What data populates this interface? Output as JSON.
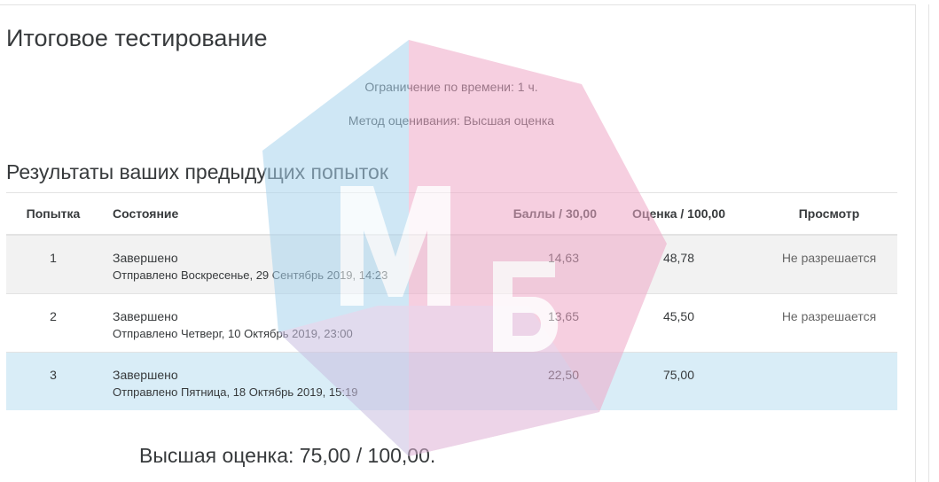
{
  "quiz": {
    "title": "Итоговое тестирование",
    "time_limit": "Ограничение по времени: 1 ч.",
    "grading_method": "Метод оценивания: Высшая оценка"
  },
  "results": {
    "heading": "Результаты ваших предыдущих попыток",
    "columns": {
      "attempt": "Попытка",
      "state": "Состояние",
      "points": "Баллы / 30,00",
      "grade": "Оценка / 100,00",
      "review": "Просмотр"
    },
    "rows": [
      {
        "attempt": "1",
        "state": "Завершено",
        "submitted": "Отправлено Воскресенье, 29 Сентябрь 2019, 14:23",
        "points": "14,63",
        "grade": "48,78",
        "review": "Не разрешается"
      },
      {
        "attempt": "2",
        "state": "Завершено",
        "submitted": "Отправлено Четверг, 10 Октябрь 2019, 23:00",
        "points": "13,65",
        "grade": "45,50",
        "review": "Не разрешается"
      },
      {
        "attempt": "3",
        "state": "Завершено",
        "submitted": "Отправлено Пятница, 18 Октябрь 2019, 15:19",
        "points": "22,50",
        "grade": "75,00",
        "review": ""
      }
    ],
    "best_grade": "Высшая оценка: 75,00 / 100,00."
  },
  "watermark": {
    "logo": "watermark-logo-icon",
    "letters": "Мб",
    "colors": {
      "blue": "#a9d4ee",
      "pink": "#f0a9c8",
      "white": "#ffffff"
    }
  },
  "colors": {
    "text": "#373a3c",
    "row_odd": "#f2f2f2",
    "row_best": "#d9edf7",
    "border": "#e3e3e3"
  }
}
